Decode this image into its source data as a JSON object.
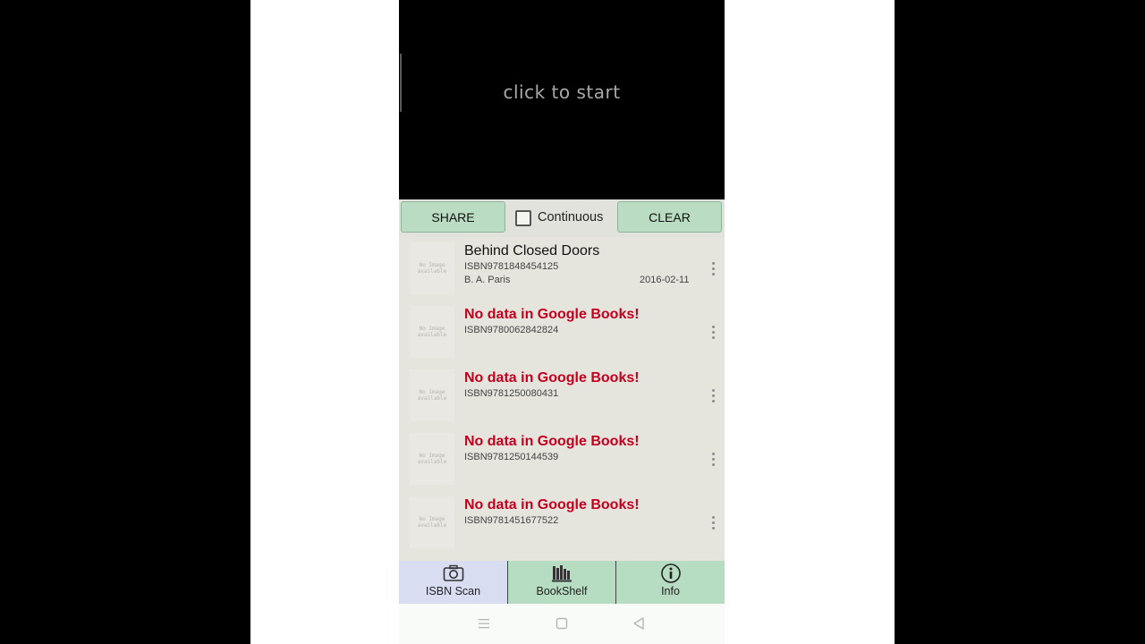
{
  "camera": {
    "hint": "click to start"
  },
  "toolbar": {
    "share_label": "SHARE",
    "continuous_label": "Continuous",
    "continuous_checked": false,
    "clear_label": "CLEAR"
  },
  "placeholder": {
    "line1": "No Image",
    "line2": "available"
  },
  "books": [
    {
      "title": "Behind Closed Doors",
      "isbn": "ISBN9781848454125",
      "author": "B. A. Paris",
      "date": "2016-02-11",
      "found": true
    },
    {
      "title": "No data in Google Books!",
      "isbn": "ISBN9780062842824",
      "found": false
    },
    {
      "title": "No data in Google Books!",
      "isbn": "ISBN9781250080431",
      "found": false
    },
    {
      "title": "No data in Google Books!",
      "isbn": "ISBN9781250144539",
      "found": false
    },
    {
      "title": "No data in Google Books!",
      "isbn": "ISBN9781451677522",
      "found": false
    }
  ],
  "nav": {
    "tabs": [
      {
        "label": "ISBN Scan",
        "icon": "camera-icon",
        "active": true
      },
      {
        "label": "BookShelf",
        "icon": "bookshelf-icon",
        "active": false
      },
      {
        "label": "Info",
        "icon": "info-icon",
        "active": false
      }
    ]
  },
  "system_nav": {
    "icons": [
      "menu-icon",
      "home-icon",
      "back-icon"
    ]
  },
  "colors": {
    "button_green": "#b9dcc2",
    "nav_green": "#b6dcc1",
    "active_tab": "#d8ddf2",
    "error_red": "#c4001e",
    "list_bg": "#e5e4dd"
  }
}
